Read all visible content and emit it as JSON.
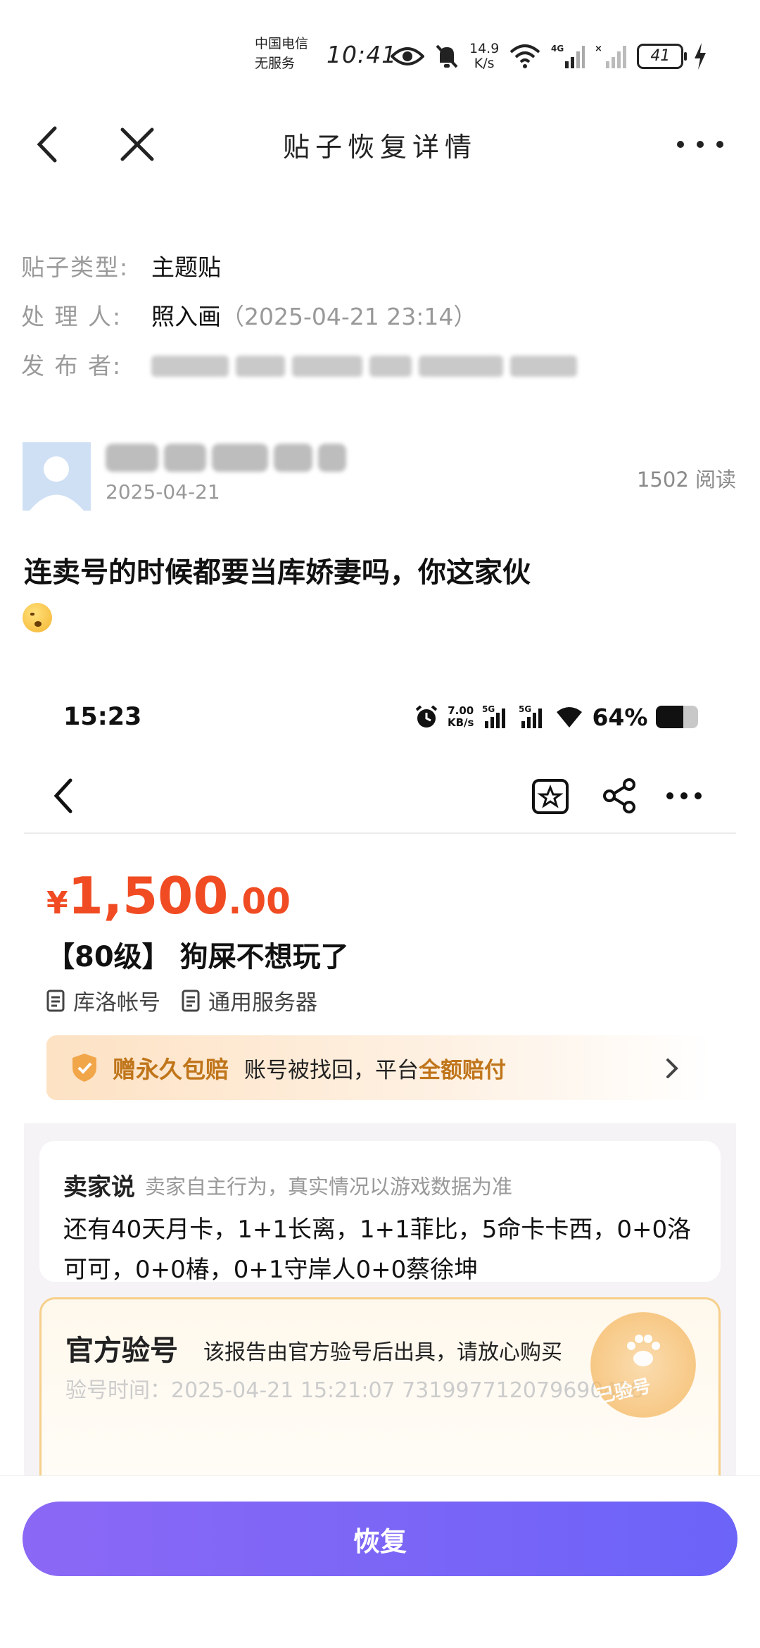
{
  "status_bar": {
    "carrier_line1": "中国电信",
    "carrier_line2": "无服务",
    "time": "10:41",
    "net_speed_value": "14.9",
    "net_speed_unit": "K/s",
    "battery": "41"
  },
  "nav": {
    "title": "贴子恢复详情"
  },
  "meta": {
    "type_label": "贴子类型:",
    "type_value": "主题贴",
    "handler_label": "处 理 人:",
    "handler_value": "照入画",
    "handler_time": "（2025-04-21 23:14）",
    "publisher_label": "发 布 者:"
  },
  "post": {
    "date": "2025-04-21",
    "read_count": "1502 阅读",
    "text": "连卖号的时候都要当库娇妻吗，你这家伙"
  },
  "screenshot": {
    "time": "15:23",
    "speed_value": "7.00",
    "speed_unit": "KB/s",
    "net1": "5G",
    "net2": "5G",
    "battery_pct": "64%",
    "battery_level": 0.64,
    "price_symbol": "¥",
    "price_int": "1,500",
    "price_dec": ".00",
    "product_title": "【80级】 狗屎不想玩了",
    "tag1": "库洛帐号",
    "tag2": "通用服务器",
    "guarantee_strong": "赠永久包赔",
    "guarantee_text": "账号被找回，平台",
    "guarantee_highlight": "全额赔付",
    "seller_title": "卖家说",
    "seller_sub": "卖家自主行为，真实情况以游戏数据为准",
    "seller_desc": "还有40天月卡，1+1长离，1+1菲比，5命卡卡西，0+0洛可可，0+0椿，0+1守岸人0+0蔡徐坤",
    "verify_title": "官方验号",
    "verify_sub": "该报告由官方验号后出具，请放心购买",
    "verify_time": "验号时间：2025-04-21 15:21:07  731997712079690488",
    "stamp_text": "已验号"
  },
  "actions": {
    "restore": "恢复"
  },
  "colors": {
    "price": "#f04b22",
    "accent_gold": "#c0751a",
    "button_start": "#8b68f5",
    "button_end": "#6c63f8"
  }
}
